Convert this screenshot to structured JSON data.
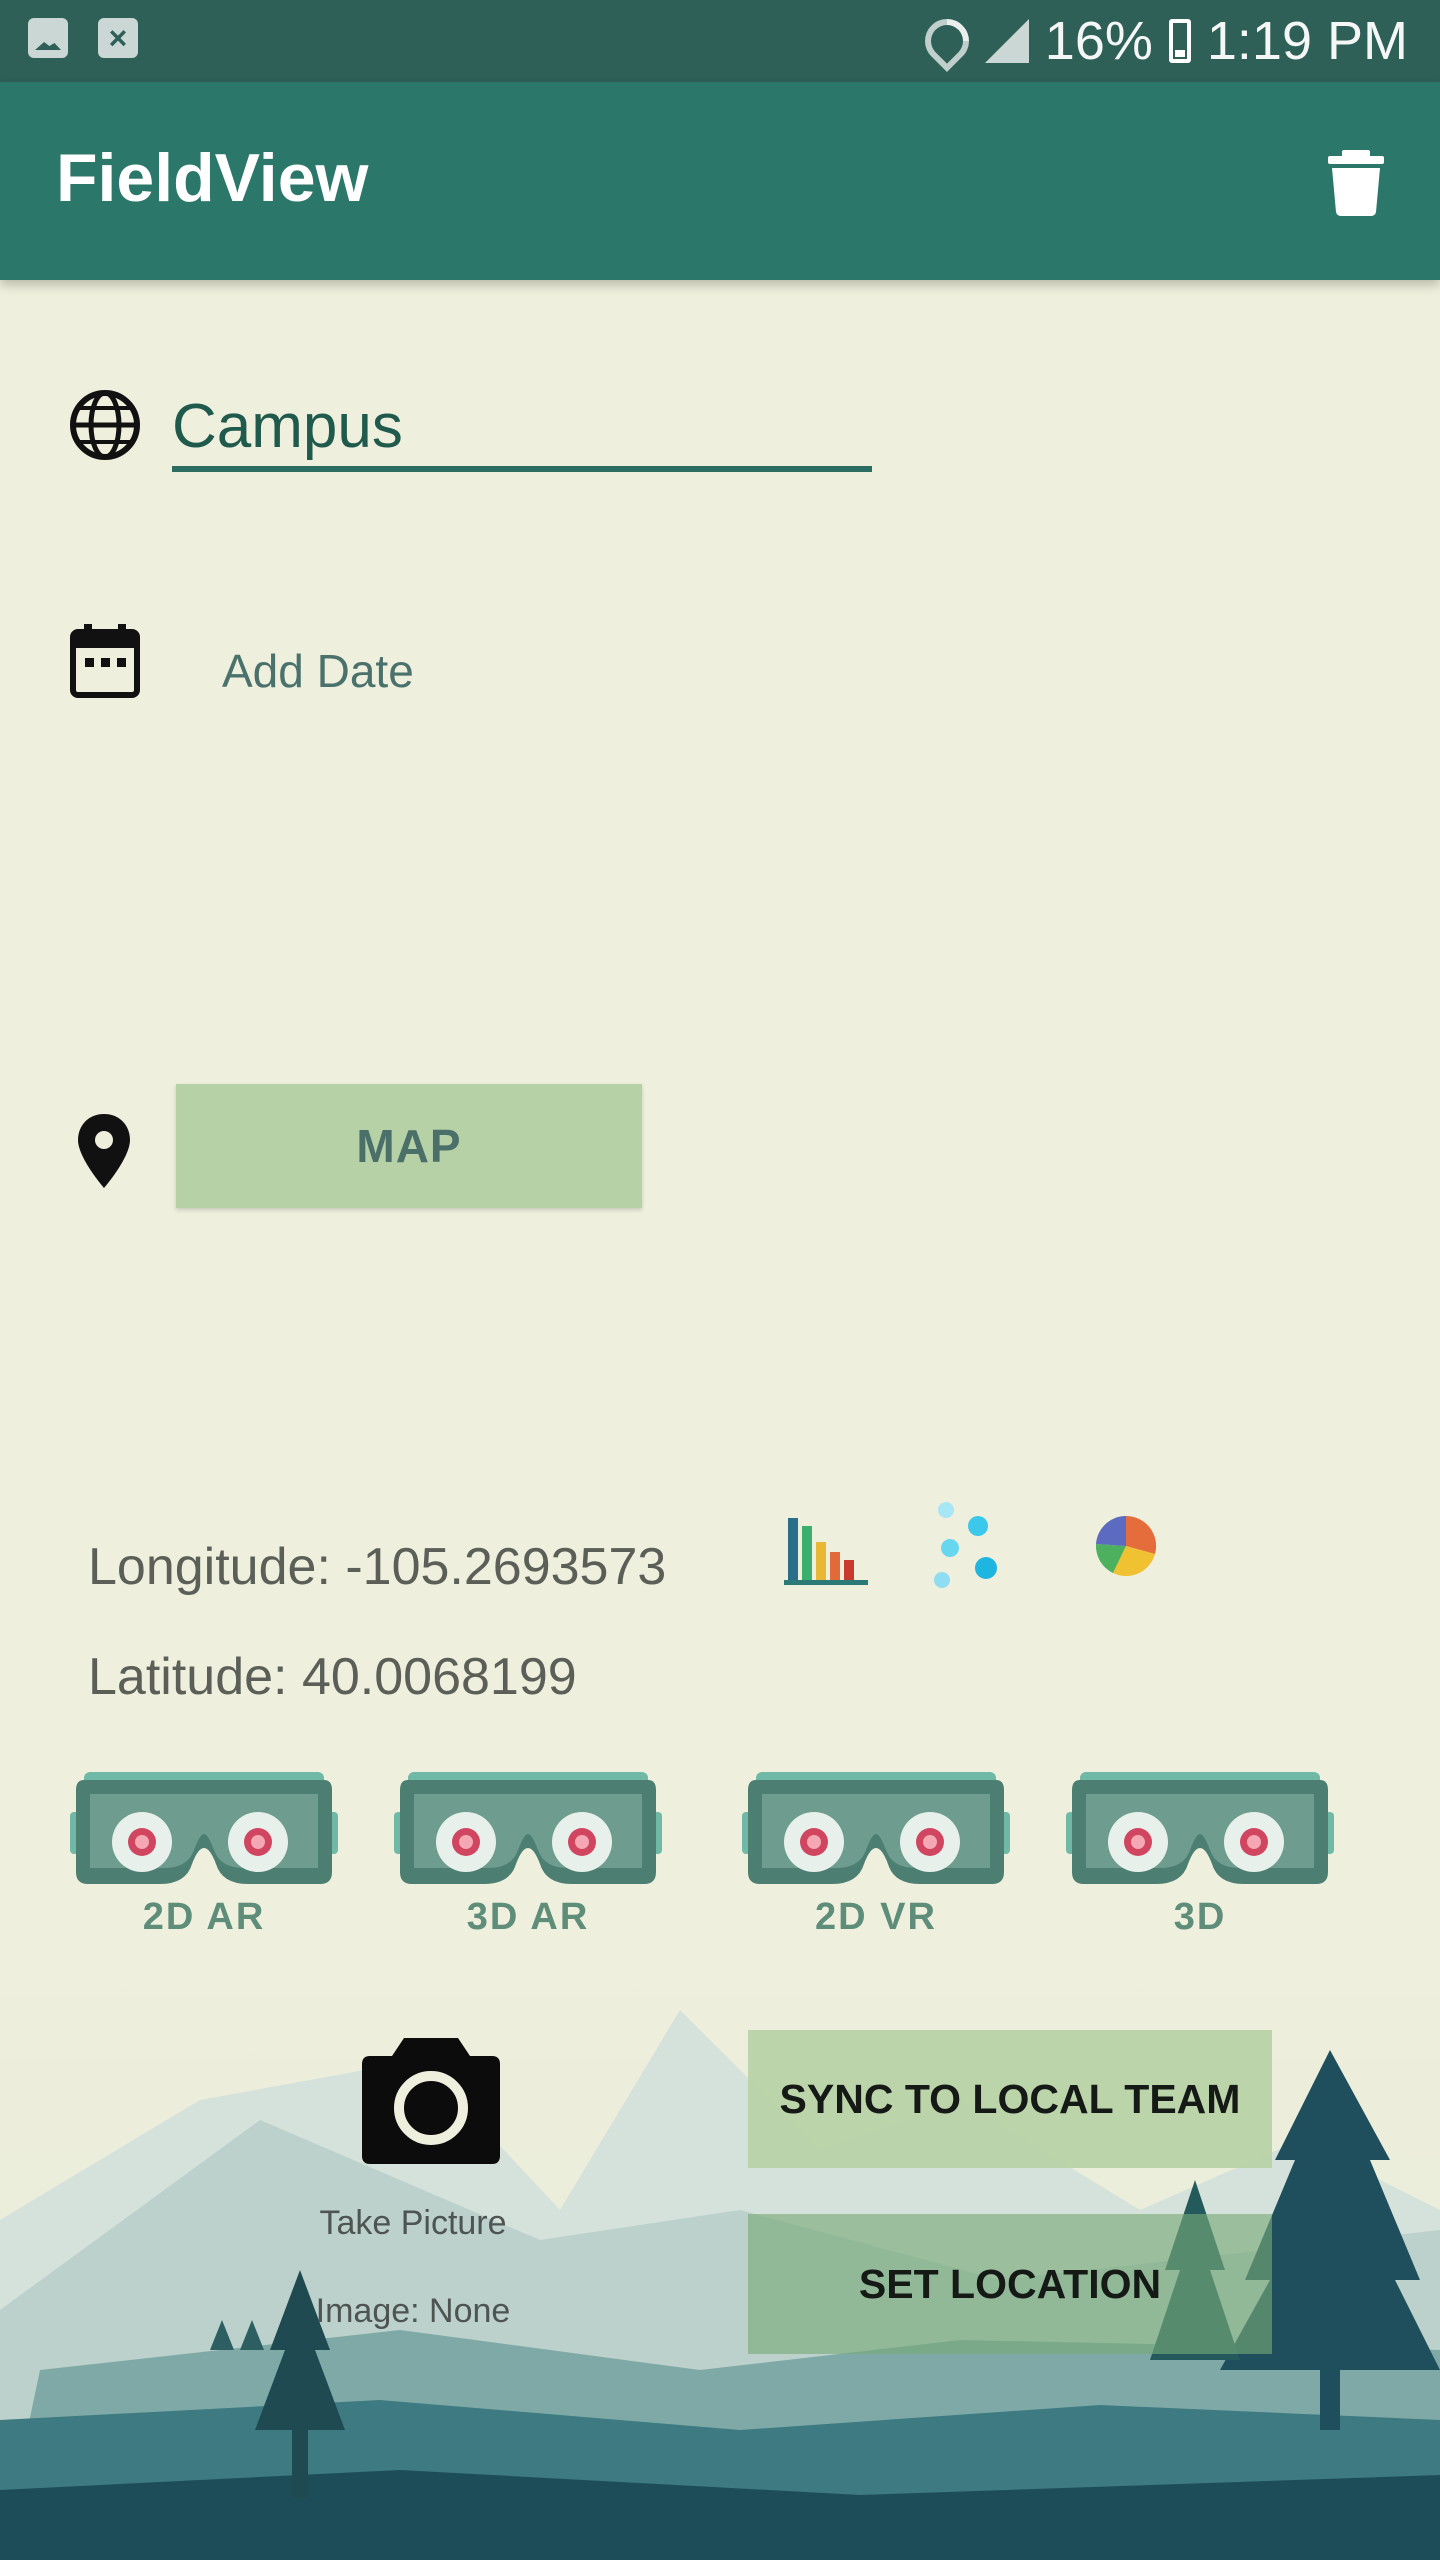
{
  "status_bar": {
    "battery": "16%",
    "time": "1:19 PM",
    "icons": [
      "gallery-notification-icon",
      "close-notification-icon",
      "wifi-icon",
      "signal-icon",
      "battery-charging-icon"
    ]
  },
  "app_bar": {
    "title": "FieldView",
    "delete_icon": "trash-icon"
  },
  "form": {
    "name_value": "Campus",
    "name_icon": "globe-icon",
    "date_label": "Add Date",
    "date_icon": "calendar-icon",
    "map_button": "MAP",
    "map_icon": "location-pin-icon"
  },
  "coordinates": {
    "longitude": "Longitude: -105.2693573",
    "latitude": "Latitude: 40.0068199"
  },
  "chart_icons": [
    "bar-chart-icon",
    "scatter-plot-icon",
    "pie-chart-icon"
  ],
  "modes": [
    {
      "label": "2D AR",
      "icon": "vr-headset-icon"
    },
    {
      "label": "3D AR",
      "icon": "vr-headset-icon"
    },
    {
      "label": "2D VR",
      "icon": "vr-headset-icon"
    },
    {
      "label": "3D",
      "icon": "vr-headset-icon"
    }
  ],
  "camera": {
    "label": "Take Picture",
    "image_status": "Image: None",
    "icon": "camera-icon"
  },
  "actions": {
    "sync": "SYNC TO LOCAL TEAM",
    "set_location": "SET LOCATION"
  },
  "colors": {
    "status_bar": "#2E6058",
    "app_bar": "#2B776A",
    "background": "#EEEFDC",
    "button": "#B7D1A6",
    "accent": "#1F5A4C"
  }
}
